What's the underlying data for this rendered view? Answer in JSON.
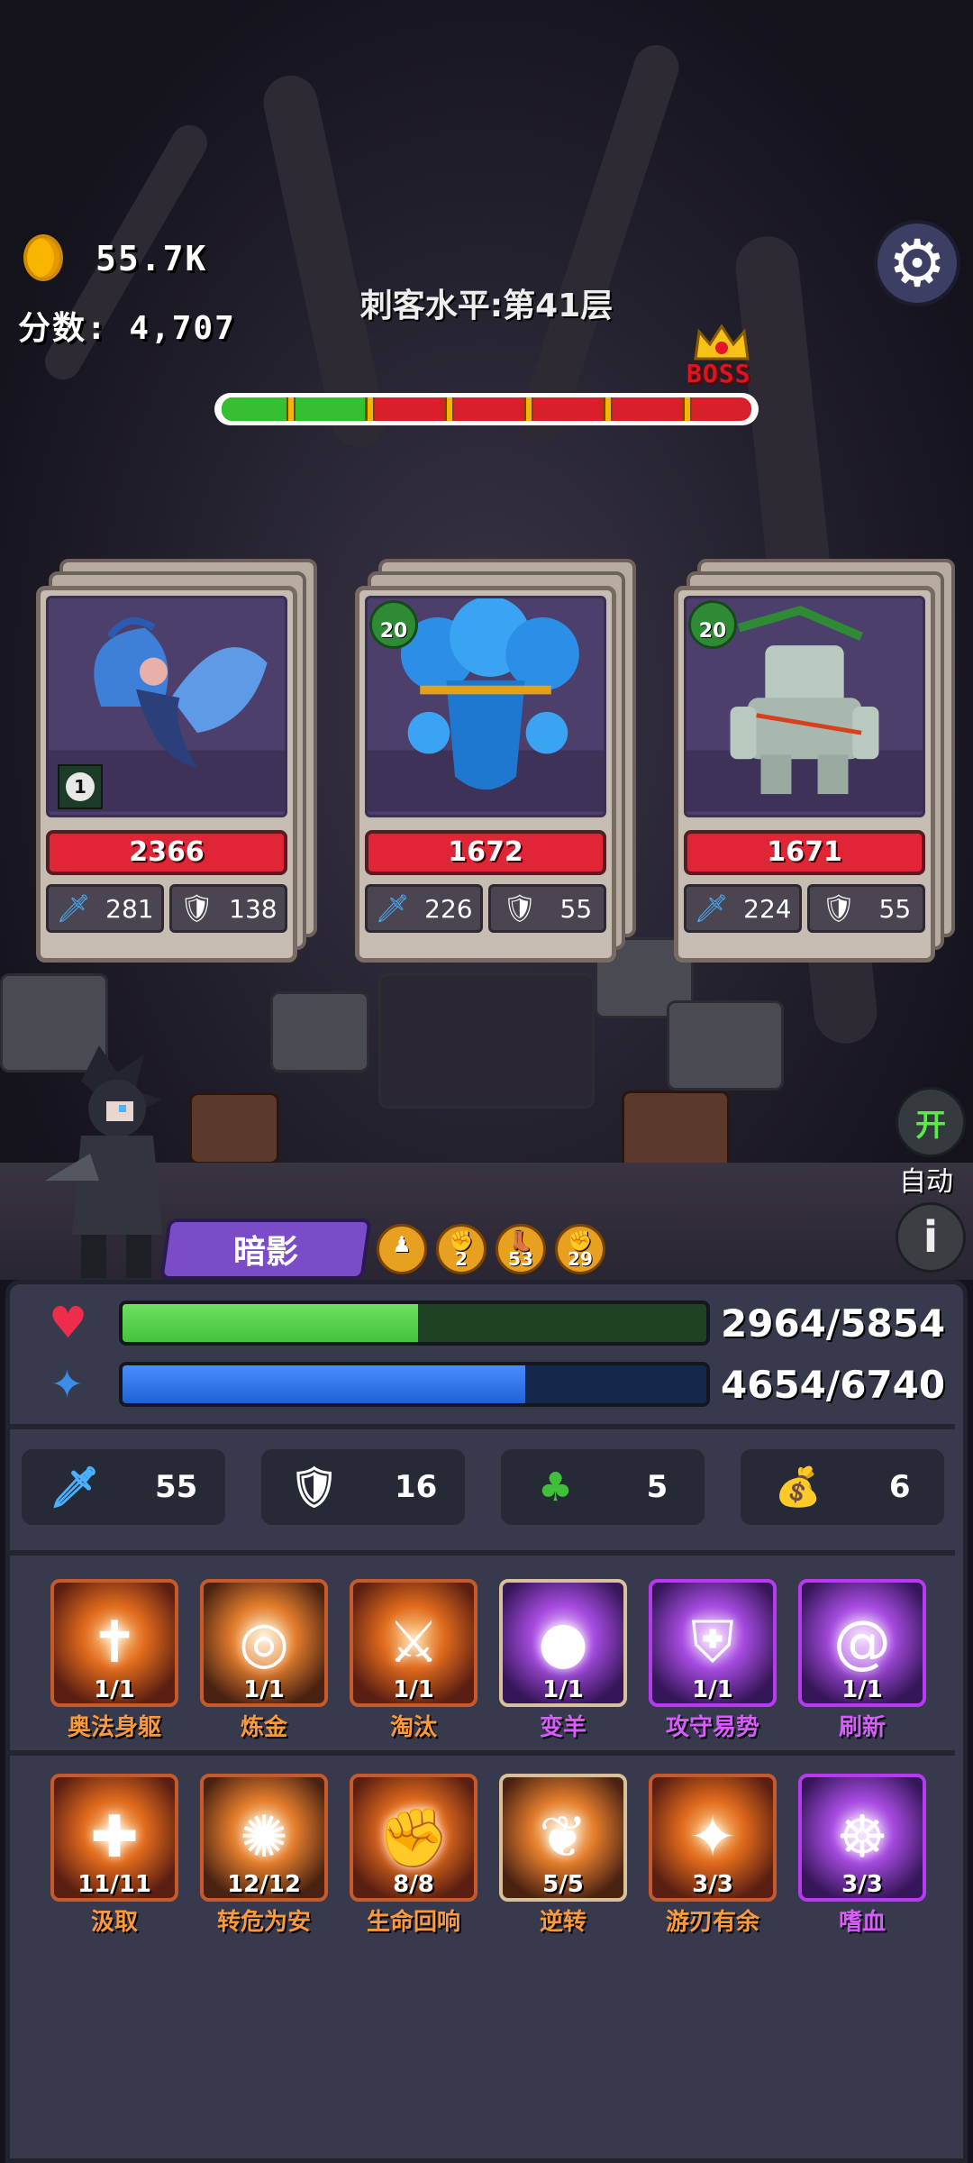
{
  "hud": {
    "coins": "55.7K",
    "score_label": "分数",
    "score_value": "4,707",
    "level_title": "刺客水平:第41层",
    "boss_label": "BOSS",
    "stage_progress": 0.27
  },
  "enemies": [
    {
      "name_icon": "harpy",
      "hp": "2366",
      "attack": "281",
      "defense": "138",
      "corner_level": "1"
    },
    {
      "name_icon": "water-elemental",
      "hp": "1672",
      "attack": "226",
      "defense": "55",
      "badge_level": "20"
    },
    {
      "name_icon": "stone-golem",
      "hp": "1671",
      "attack": "224",
      "defense": "55",
      "badge_level": "20"
    }
  ],
  "side": {
    "auto_toggle": "开",
    "auto_label": "自动"
  },
  "hero": {
    "name": "暗影",
    "buffs": [
      {
        "icon": "figure-icon",
        "count": ""
      },
      {
        "icon": "fist-icon",
        "count": "2"
      },
      {
        "icon": "boot-icon",
        "count": "53"
      },
      {
        "icon": "fist-icon",
        "count": "29"
      }
    ]
  },
  "panel": {
    "hp": {
      "current": "2964/5854",
      "fraction": 0.506,
      "color": "#43c43c"
    },
    "mp": {
      "current": "4654/6740",
      "fraction": 0.69,
      "color": "#1e63d6"
    },
    "stats": {
      "attack": "55",
      "defense": "16",
      "luck": "5",
      "bag": "6"
    },
    "skills_row1": [
      {
        "name": "奥法身躯",
        "count": "1/1",
        "style": "orange"
      },
      {
        "name": "炼金",
        "count": "1/1",
        "style": "orange"
      },
      {
        "name": "淘汰",
        "count": "1/1",
        "style": "orange"
      },
      {
        "name": "变羊",
        "count": "1/1",
        "style": "purple"
      },
      {
        "name": "攻守易势",
        "count": "1/1",
        "style": "purple"
      },
      {
        "name": "刷新",
        "count": "1/1",
        "style": "purple"
      }
    ],
    "skills_row2": [
      {
        "name": "汲取",
        "count": "11/11",
        "style": "orange"
      },
      {
        "name": "转危为安",
        "count": "12/12",
        "style": "orange"
      },
      {
        "name": "生命回响",
        "count": "8/8",
        "style": "orange"
      },
      {
        "name": "逆转",
        "count": "5/5",
        "style": "beige"
      },
      {
        "name": "游刃有余",
        "count": "3/3",
        "style": "orange"
      },
      {
        "name": "嗜血",
        "count": "3/3",
        "style": "purple"
      }
    ]
  }
}
